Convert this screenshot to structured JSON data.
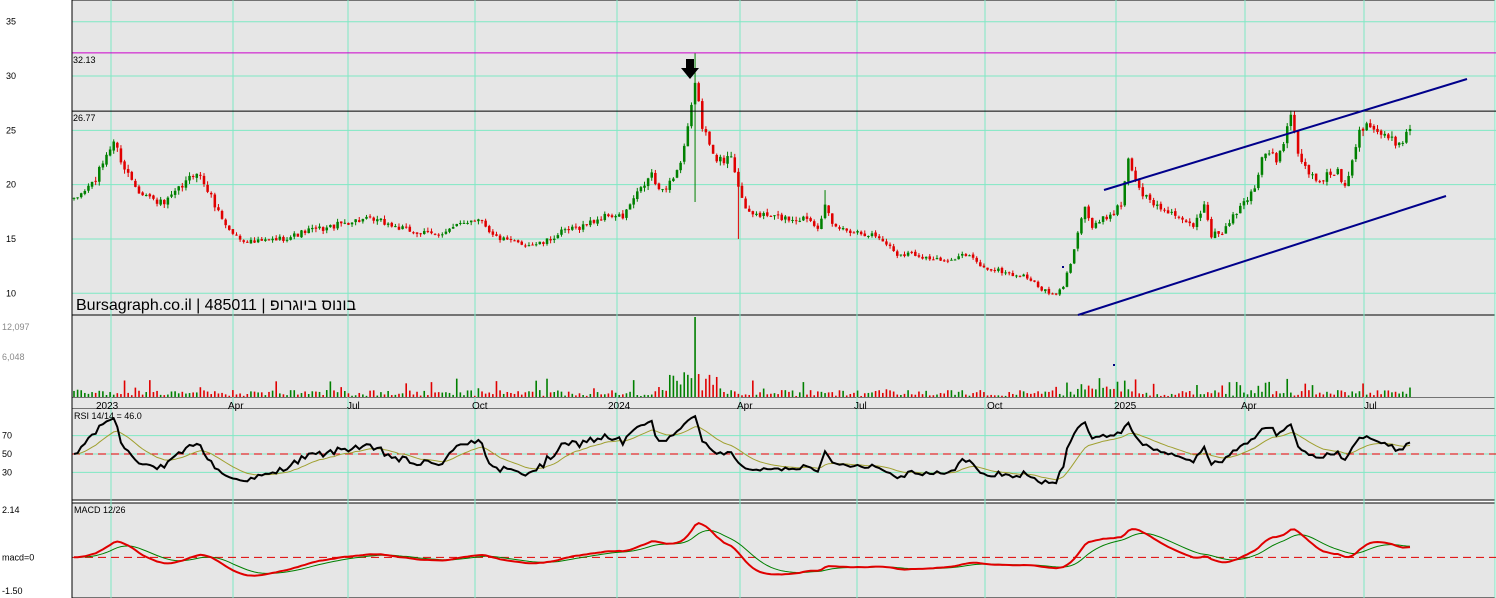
{
  "chart_data": {
    "type": "candlestick",
    "watermark": "Bursagraph.co.il | 485011 | בונוס ביוגרופ",
    "x_labels": [
      "2023",
      "Apr",
      "Jul",
      "Oct",
      "2024",
      "Apr",
      "Jul",
      "Oct",
      "2025",
      "Apr",
      "Jul"
    ],
    "price": {
      "ylim": [
        8,
        37
      ],
      "ticks": [
        10,
        15,
        20,
        25,
        30,
        35
      ],
      "levels": [
        {
          "value": 32.13,
          "label": "32.13",
          "color": "#cc00cc"
        },
        {
          "value": 26.77,
          "label": "26.77",
          "color": "#000000"
        }
      ],
      "up_color": "#008000",
      "down_color": "#e00000",
      "anchors": [
        [
          0,
          18.5
        ],
        [
          3,
          19.5
        ],
        [
          6,
          20.5
        ],
        [
          9,
          22.8
        ],
        [
          11,
          24
        ],
        [
          14,
          21.5
        ],
        [
          18,
          19.5
        ],
        [
          22,
          18.6
        ],
        [
          25,
          18.2
        ],
        [
          28,
          19.2
        ],
        [
          31,
          20.2
        ],
        [
          34,
          21.3
        ],
        [
          37,
          19.5
        ],
        [
          40,
          17.5
        ],
        [
          43,
          15.8
        ],
        [
          46,
          15
        ],
        [
          50,
          14.7
        ],
        [
          55,
          14.9
        ],
        [
          60,
          15.2
        ],
        [
          65,
          15.8
        ],
        [
          70,
          16
        ],
        [
          75,
          16.5
        ],
        [
          80,
          16.8
        ],
        [
          85,
          16.6
        ],
        [
          90,
          16
        ],
        [
          95,
          15.6
        ],
        [
          100,
          15.4
        ],
        [
          105,
          16
        ],
        [
          110,
          16.8
        ],
        [
          113,
          16.8
        ],
        [
          116,
          15.3
        ],
        [
          120,
          14.8
        ],
        [
          125,
          14.5
        ],
        [
          130,
          14.6
        ],
        [
          135,
          15.6
        ],
        [
          140,
          16.1
        ],
        [
          145,
          16.8
        ],
        [
          148,
          17.2
        ],
        [
          152,
          17
        ],
        [
          155,
          18.7
        ],
        [
          158,
          20
        ],
        [
          160,
          21
        ],
        [
          162,
          19.3
        ],
        [
          165,
          20.2
        ],
        [
          168,
          22
        ],
        [
          170,
          25
        ],
        [
          172,
          29
        ],
        [
          173,
          28
        ],
        [
          174,
          25
        ],
        [
          176,
          24
        ],
        [
          178,
          22.5
        ],
        [
          180,
          22
        ],
        [
          182,
          22.8
        ],
        [
          184,
          20
        ],
        [
          186,
          17.5
        ],
        [
          190,
          17.2
        ],
        [
          195,
          17
        ],
        [
          200,
          16.8
        ],
        [
          203,
          17
        ],
        [
          206,
          16.2
        ],
        [
          208,
          18
        ],
        [
          210,
          16.2
        ],
        [
          213,
          15.9
        ],
        [
          218,
          15.6
        ],
        [
          222,
          15.3
        ],
        [
          225,
          14.6
        ],
        [
          228,
          13.6
        ],
        [
          232,
          13.7
        ],
        [
          236,
          13.3
        ],
        [
          240,
          13
        ],
        [
          242,
          12.8
        ],
        [
          245,
          13.6
        ],
        [
          248,
          13.4
        ],
        [
          252,
          12.3
        ],
        [
          256,
          12.1
        ],
        [
          260,
          11.7
        ],
        [
          264,
          11.5
        ],
        [
          267,
          10.6
        ],
        [
          270,
          10
        ],
        [
          272,
          9.8
        ],
        [
          274,
          10.7
        ],
        [
          276,
          12.8
        ],
        [
          278,
          15.8
        ],
        [
          280,
          18
        ],
        [
          282,
          16
        ],
        [
          285,
          16.8
        ],
        [
          288,
          17.5
        ],
        [
          290,
          18.2
        ],
        [
          292,
          22.5
        ],
        [
          295,
          19.5
        ],
        [
          298,
          18.5
        ],
        [
          301,
          17.8
        ],
        [
          304,
          17.5
        ],
        [
          307,
          16.5
        ],
        [
          310,
          16.2
        ],
        [
          313,
          18.2
        ],
        [
          315,
          15.4
        ],
        [
          318,
          15.6
        ],
        [
          320,
          16.5
        ],
        [
          322,
          17.5
        ],
        [
          324,
          18.3
        ],
        [
          327,
          19.8
        ],
        [
          329,
          22.5
        ],
        [
          331,
          23.2
        ],
        [
          333,
          22
        ],
        [
          335,
          24
        ],
        [
          337,
          26.2
        ],
        [
          339,
          23
        ],
        [
          341,
          21.5
        ],
        [
          344,
          20.3
        ],
        [
          347,
          20.8
        ],
        [
          350,
          21.3
        ],
        [
          352,
          19.8
        ],
        [
          354,
          22.5
        ],
        [
          356,
          25
        ],
        [
          358,
          25.8
        ],
        [
          361,
          24.8
        ],
        [
          364,
          24.2
        ],
        [
          367,
          23.8
        ],
        [
          370,
          25.2
        ]
      ]
    },
    "volume": {
      "labels": [
        "12,097",
        "6,048"
      ]
    },
    "rsi": {
      "label": "RSI 14/14 = 46.0",
      "ylim": [
        0,
        100
      ],
      "ticks": [
        30,
        50,
        70
      ],
      "midline": 50
    },
    "macd": {
      "label": "MACD 12/26",
      "top_label": "2.14",
      "zero_label": "macd=0",
      "bottom_label": "-1.50",
      "ylim": [
        -1.5,
        2.14
      ]
    }
  }
}
